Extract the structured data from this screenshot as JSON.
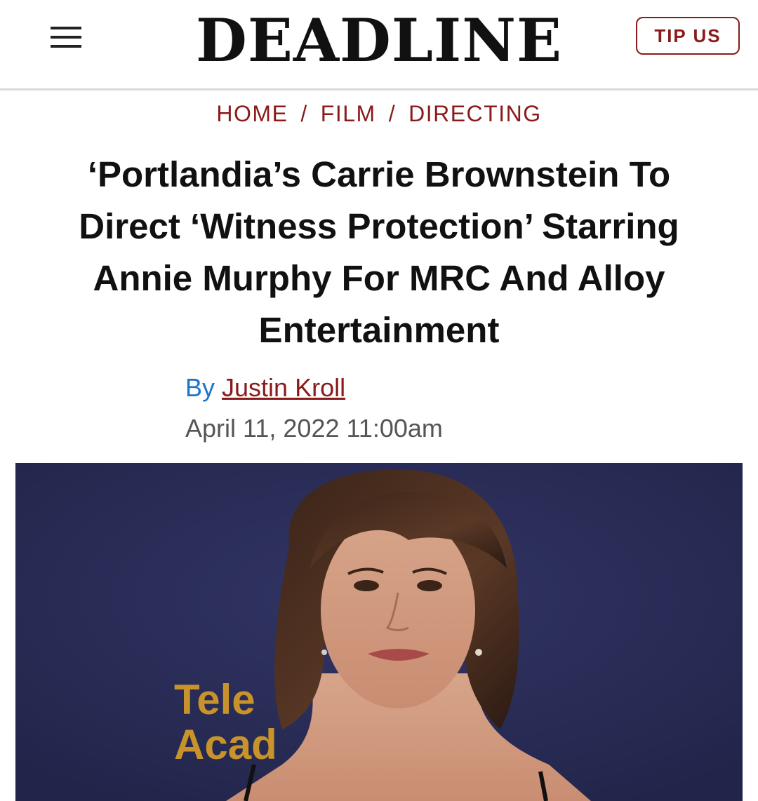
{
  "header": {
    "logo": "DEADLINE",
    "tip_label": "TIP US"
  },
  "breadcrumb": {
    "items": [
      "HOME",
      "FILM",
      "DIRECTING"
    ],
    "separator": "/"
  },
  "article": {
    "title_lines": [
      "‘Portlandia’s Carrie Brownstein To",
      "Direct ‘Witness Protection’ Starring",
      "Annie Murphy For MRC And Alloy",
      "Entertainment"
    ],
    "by_label": "By",
    "author": "Justin Kroll",
    "date": "April 11, 2022 11:00am"
  },
  "photo": {
    "backdrop_text_line1": "Tele",
    "backdrop_text_line2": "Acad"
  },
  "colors": {
    "accent": "#8b1a1a",
    "byline_blue": "#1e74c8",
    "backdrop": "#2a2d55",
    "backdrop_logo": "#c8932a"
  }
}
